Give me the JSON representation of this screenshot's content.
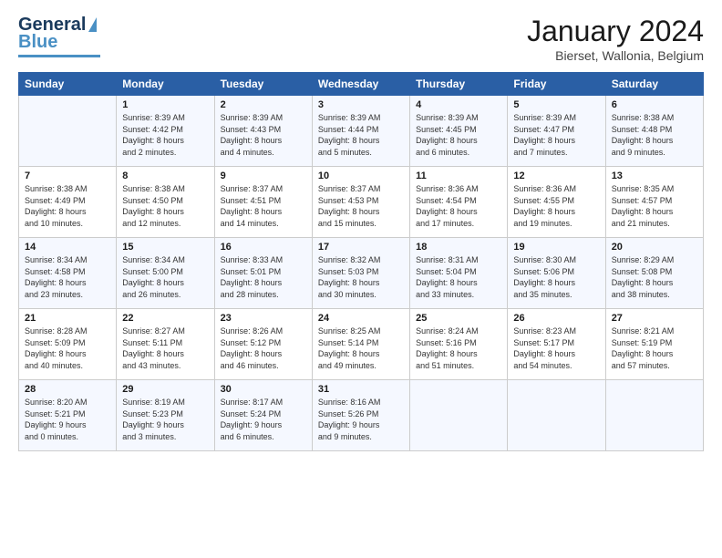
{
  "header": {
    "logo_line1": "General",
    "logo_line2": "Blue",
    "month_title": "January 2024",
    "subtitle": "Bierset, Wallonia, Belgium"
  },
  "weekdays": [
    "Sunday",
    "Monday",
    "Tuesday",
    "Wednesday",
    "Thursday",
    "Friday",
    "Saturday"
  ],
  "weeks": [
    [
      {
        "day": "",
        "lines": []
      },
      {
        "day": "1",
        "lines": [
          "Sunrise: 8:39 AM",
          "Sunset: 4:42 PM",
          "Daylight: 8 hours",
          "and 2 minutes."
        ]
      },
      {
        "day": "2",
        "lines": [
          "Sunrise: 8:39 AM",
          "Sunset: 4:43 PM",
          "Daylight: 8 hours",
          "and 4 minutes."
        ]
      },
      {
        "day": "3",
        "lines": [
          "Sunrise: 8:39 AM",
          "Sunset: 4:44 PM",
          "Daylight: 8 hours",
          "and 5 minutes."
        ]
      },
      {
        "day": "4",
        "lines": [
          "Sunrise: 8:39 AM",
          "Sunset: 4:45 PM",
          "Daylight: 8 hours",
          "and 6 minutes."
        ]
      },
      {
        "day": "5",
        "lines": [
          "Sunrise: 8:39 AM",
          "Sunset: 4:47 PM",
          "Daylight: 8 hours",
          "and 7 minutes."
        ]
      },
      {
        "day": "6",
        "lines": [
          "Sunrise: 8:38 AM",
          "Sunset: 4:48 PM",
          "Daylight: 8 hours",
          "and 9 minutes."
        ]
      }
    ],
    [
      {
        "day": "7",
        "lines": [
          "Sunrise: 8:38 AM",
          "Sunset: 4:49 PM",
          "Daylight: 8 hours",
          "and 10 minutes."
        ]
      },
      {
        "day": "8",
        "lines": [
          "Sunrise: 8:38 AM",
          "Sunset: 4:50 PM",
          "Daylight: 8 hours",
          "and 12 minutes."
        ]
      },
      {
        "day": "9",
        "lines": [
          "Sunrise: 8:37 AM",
          "Sunset: 4:51 PM",
          "Daylight: 8 hours",
          "and 14 minutes."
        ]
      },
      {
        "day": "10",
        "lines": [
          "Sunrise: 8:37 AM",
          "Sunset: 4:53 PM",
          "Daylight: 8 hours",
          "and 15 minutes."
        ]
      },
      {
        "day": "11",
        "lines": [
          "Sunrise: 8:36 AM",
          "Sunset: 4:54 PM",
          "Daylight: 8 hours",
          "and 17 minutes."
        ]
      },
      {
        "day": "12",
        "lines": [
          "Sunrise: 8:36 AM",
          "Sunset: 4:55 PM",
          "Daylight: 8 hours",
          "and 19 minutes."
        ]
      },
      {
        "day": "13",
        "lines": [
          "Sunrise: 8:35 AM",
          "Sunset: 4:57 PM",
          "Daylight: 8 hours",
          "and 21 minutes."
        ]
      }
    ],
    [
      {
        "day": "14",
        "lines": [
          "Sunrise: 8:34 AM",
          "Sunset: 4:58 PM",
          "Daylight: 8 hours",
          "and 23 minutes."
        ]
      },
      {
        "day": "15",
        "lines": [
          "Sunrise: 8:34 AM",
          "Sunset: 5:00 PM",
          "Daylight: 8 hours",
          "and 26 minutes."
        ]
      },
      {
        "day": "16",
        "lines": [
          "Sunrise: 8:33 AM",
          "Sunset: 5:01 PM",
          "Daylight: 8 hours",
          "and 28 minutes."
        ]
      },
      {
        "day": "17",
        "lines": [
          "Sunrise: 8:32 AM",
          "Sunset: 5:03 PM",
          "Daylight: 8 hours",
          "and 30 minutes."
        ]
      },
      {
        "day": "18",
        "lines": [
          "Sunrise: 8:31 AM",
          "Sunset: 5:04 PM",
          "Daylight: 8 hours",
          "and 33 minutes."
        ]
      },
      {
        "day": "19",
        "lines": [
          "Sunrise: 8:30 AM",
          "Sunset: 5:06 PM",
          "Daylight: 8 hours",
          "and 35 minutes."
        ]
      },
      {
        "day": "20",
        "lines": [
          "Sunrise: 8:29 AM",
          "Sunset: 5:08 PM",
          "Daylight: 8 hours",
          "and 38 minutes."
        ]
      }
    ],
    [
      {
        "day": "21",
        "lines": [
          "Sunrise: 8:28 AM",
          "Sunset: 5:09 PM",
          "Daylight: 8 hours",
          "and 40 minutes."
        ]
      },
      {
        "day": "22",
        "lines": [
          "Sunrise: 8:27 AM",
          "Sunset: 5:11 PM",
          "Daylight: 8 hours",
          "and 43 minutes."
        ]
      },
      {
        "day": "23",
        "lines": [
          "Sunrise: 8:26 AM",
          "Sunset: 5:12 PM",
          "Daylight: 8 hours",
          "and 46 minutes."
        ]
      },
      {
        "day": "24",
        "lines": [
          "Sunrise: 8:25 AM",
          "Sunset: 5:14 PM",
          "Daylight: 8 hours",
          "and 49 minutes."
        ]
      },
      {
        "day": "25",
        "lines": [
          "Sunrise: 8:24 AM",
          "Sunset: 5:16 PM",
          "Daylight: 8 hours",
          "and 51 minutes."
        ]
      },
      {
        "day": "26",
        "lines": [
          "Sunrise: 8:23 AM",
          "Sunset: 5:17 PM",
          "Daylight: 8 hours",
          "and 54 minutes."
        ]
      },
      {
        "day": "27",
        "lines": [
          "Sunrise: 8:21 AM",
          "Sunset: 5:19 PM",
          "Daylight: 8 hours",
          "and 57 minutes."
        ]
      }
    ],
    [
      {
        "day": "28",
        "lines": [
          "Sunrise: 8:20 AM",
          "Sunset: 5:21 PM",
          "Daylight: 9 hours",
          "and 0 minutes."
        ]
      },
      {
        "day": "29",
        "lines": [
          "Sunrise: 8:19 AM",
          "Sunset: 5:23 PM",
          "Daylight: 9 hours",
          "and 3 minutes."
        ]
      },
      {
        "day": "30",
        "lines": [
          "Sunrise: 8:17 AM",
          "Sunset: 5:24 PM",
          "Daylight: 9 hours",
          "and 6 minutes."
        ]
      },
      {
        "day": "31",
        "lines": [
          "Sunrise: 8:16 AM",
          "Sunset: 5:26 PM",
          "Daylight: 9 hours",
          "and 9 minutes."
        ]
      },
      {
        "day": "",
        "lines": []
      },
      {
        "day": "",
        "lines": []
      },
      {
        "day": "",
        "lines": []
      }
    ]
  ]
}
